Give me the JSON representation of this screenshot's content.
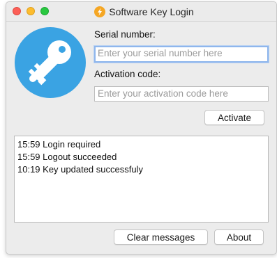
{
  "window": {
    "title": "Software Key Login",
    "controls": [
      "close",
      "minimize",
      "maximize"
    ]
  },
  "colors": {
    "accent_blue": "#3aa3e3",
    "title_icon_orange": "#f5a623",
    "focus_ring": "#8fb6ec"
  },
  "icons": {
    "title": "lightning-bolt-icon",
    "main": "key-icon"
  },
  "form": {
    "serial_label": "Serial number:",
    "serial_placeholder": "Enter your serial number here",
    "activation_label": "Activation code:",
    "activation_placeholder": "Enter your activation code here",
    "activate_label": "Activate"
  },
  "log": {
    "messages": [
      "15:59 Login required",
      "15:59 Logout succeeded",
      "10:19 Key updated successfuly"
    ]
  },
  "footer": {
    "clear_label": "Clear messages",
    "about_label": "About"
  }
}
